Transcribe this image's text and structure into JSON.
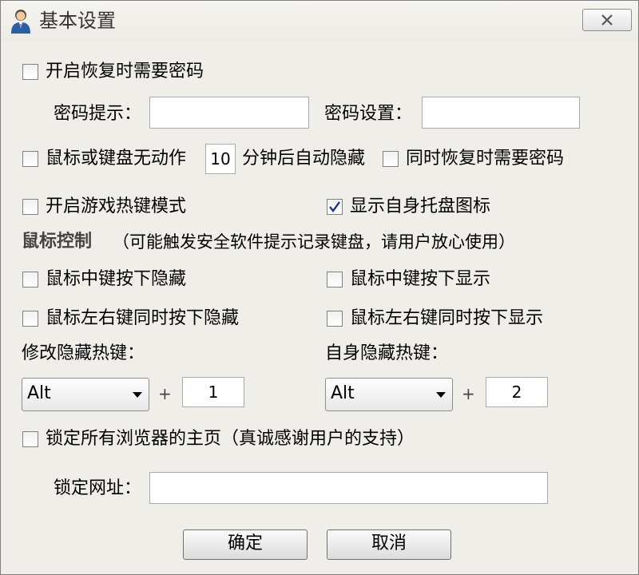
{
  "window": {
    "title": "基本设置",
    "close_icon": "close-icon"
  },
  "restore_password": {
    "checkbox_label": "开启恢复时需要密码",
    "checked": false,
    "hint_label": "密码提示：",
    "hint_value": "",
    "password_label": "密码设置：",
    "password_value": ""
  },
  "auto_hide": {
    "label_prefix": "鼠标或键盘无动作",
    "minutes_value": "10",
    "label_suffix": "分钟后自动隐藏",
    "checked": false,
    "also_password_label": "同时恢复时需要密码",
    "also_password_checked": false
  },
  "game_mode": {
    "label": "开启游戏热键模式",
    "checked": false
  },
  "tray_icon": {
    "label": "显示自身托盘图标",
    "checked": true
  },
  "mouse_control": {
    "heading": "鼠标控制",
    "note": "（可能触发安全软件提示记录键盘，请用户放心使用）",
    "middle_hide_label": "鼠标中键按下隐藏",
    "middle_hide_checked": false,
    "middle_show_label": "鼠标中键按下显示",
    "middle_show_checked": false,
    "lr_hide_label": "鼠标左右键同时按下隐藏",
    "lr_hide_checked": false,
    "lr_show_label": "鼠标左右键同时按下显示",
    "lr_show_checked": false
  },
  "hotkeys": {
    "modify_label": "修改隐藏热键：",
    "modify_modifier": "Alt",
    "modify_plus": "+",
    "modify_key": "1",
    "self_label": "自身隐藏热键：",
    "self_modifier": "Alt",
    "self_plus": "+",
    "self_key": "2"
  },
  "homepage": {
    "lock_label": "锁定所有浏览器的主页（真诚感谢用户的支持）",
    "checked": false,
    "url_label": "锁定网址：",
    "url_value": ""
  },
  "buttons": {
    "ok": "确定",
    "cancel": "取消"
  },
  "colors": {
    "window_bg": "#f0eee8",
    "check_mark": "#1e3a8a"
  }
}
